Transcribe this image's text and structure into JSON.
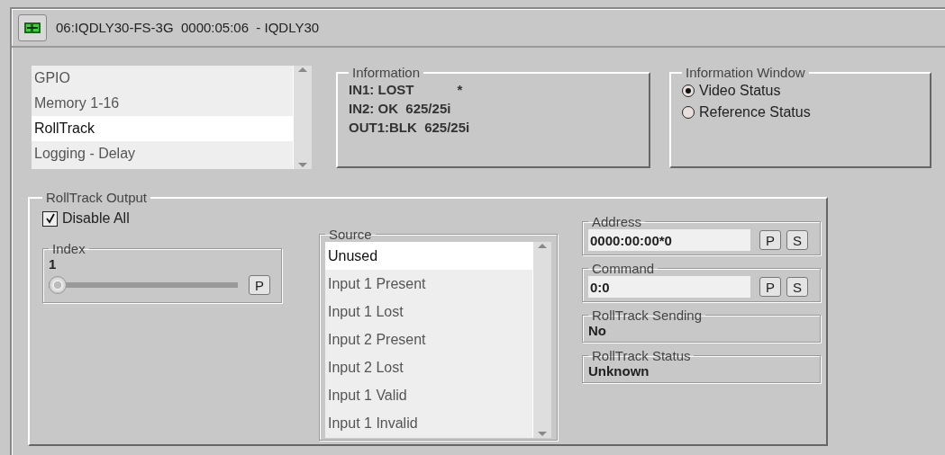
{
  "header": {
    "title": "06:IQDLY30-FS-3G  0000:05:06  - IQDLY30"
  },
  "menu": {
    "items": [
      {
        "label": "GPIO",
        "selected": false
      },
      {
        "label": "Memory 1-16",
        "selected": false
      },
      {
        "label": "RollTrack",
        "selected": true
      },
      {
        "label": "Logging - Delay",
        "selected": false
      }
    ]
  },
  "information": {
    "title": "Information",
    "lines": [
      {
        "text": "IN1: LOST",
        "note": "*"
      },
      {
        "text": "IN2: OK  625/25i"
      },
      {
        "text": "OUT1:BLK  625/25i"
      }
    ]
  },
  "information_window": {
    "title": "Information Window",
    "options": [
      {
        "label": "Video Status",
        "selected": true
      },
      {
        "label": "Reference Status",
        "selected": false
      }
    ]
  },
  "rolltrack_output": {
    "title": "RollTrack Output",
    "disable_all": {
      "label": "Disable All",
      "checked": true
    },
    "index": {
      "title": "Index",
      "value": "1",
      "level": 0,
      "button": "P"
    },
    "source": {
      "title": "Source",
      "items": [
        {
          "label": "Unused",
          "selected": true
        },
        {
          "label": "Input 1 Present",
          "selected": false
        },
        {
          "label": "Input 1 Lost",
          "selected": false
        },
        {
          "label": "Input 2 Present",
          "selected": false
        },
        {
          "label": "Input 2 Lost",
          "selected": false
        },
        {
          "label": "Input 1 Valid",
          "selected": false
        },
        {
          "label": "Input 1 Invalid",
          "selected": false
        }
      ]
    },
    "address": {
      "title": "Address",
      "value": "0000:00:00*0",
      "buttons": [
        "P",
        "S"
      ]
    },
    "command": {
      "title": "Command",
      "value": "0:0",
      "buttons": [
        "P",
        "S"
      ]
    },
    "sending": {
      "title": "RollTrack Sending",
      "value": "No"
    },
    "status": {
      "title": "RollTrack Status",
      "value": "Unknown"
    }
  }
}
